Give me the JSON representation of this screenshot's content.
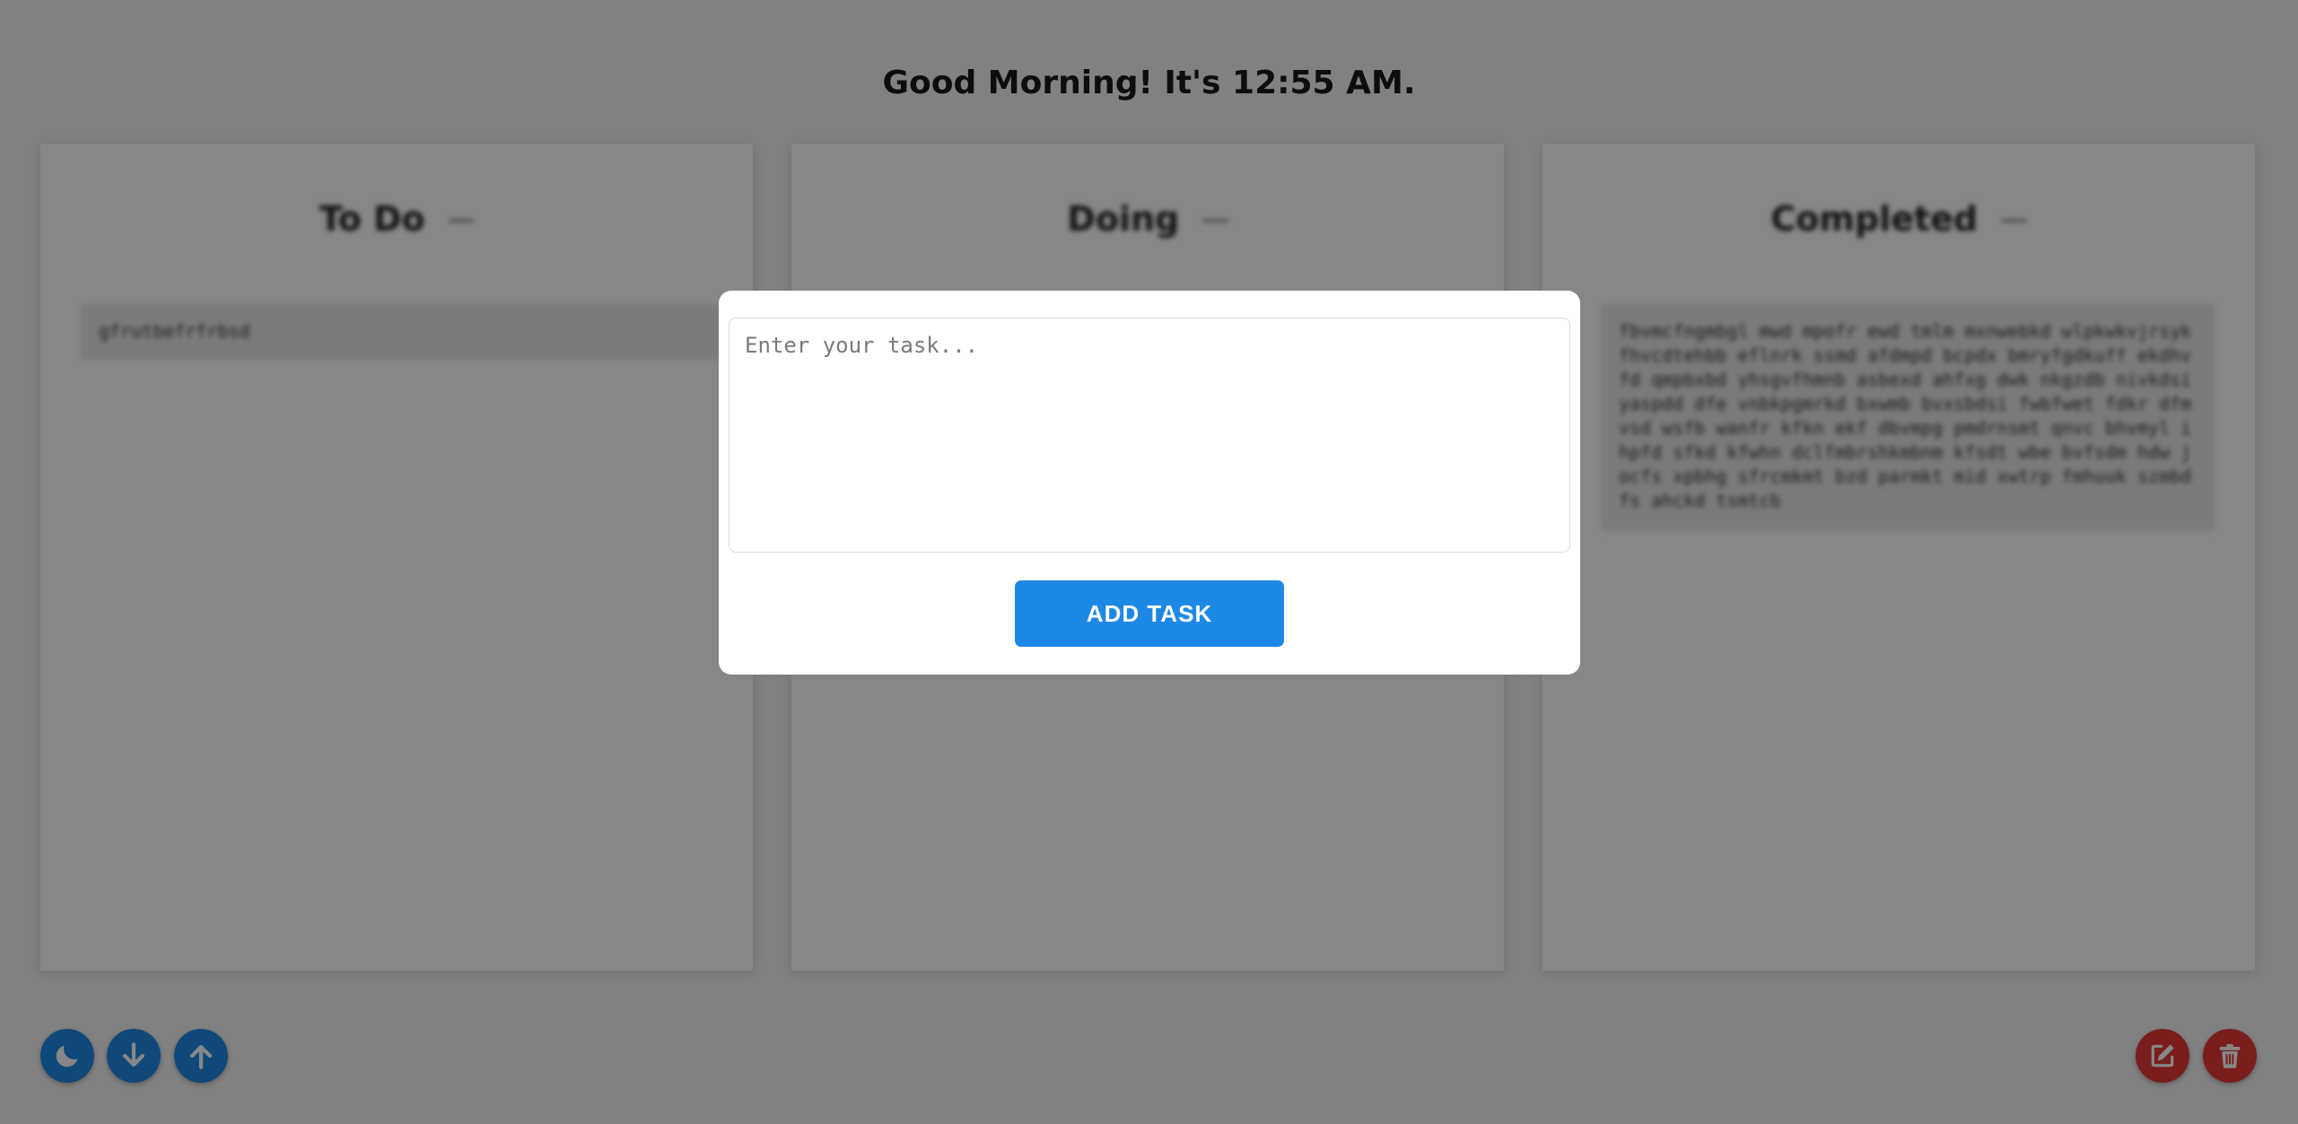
{
  "header": {
    "greeting": "Good Morning! It's 12:55 AM."
  },
  "columns": [
    {
      "title": "To Do",
      "toggle_icon": "minus-icon",
      "tasks": [
        "gfrutbefrfrbsd"
      ]
    },
    {
      "title": "Doing",
      "toggle_icon": "minus-icon",
      "tasks": []
    },
    {
      "title": "Completed",
      "toggle_icon": "minus-icon",
      "tasks": [
        "fbvmcfngmbgl mwd mpofr ewd tmlm mxnwebkd wlpkwkvjrsyk fhvcdtehbb eflnrk ssmd afdmpd bcpdx bmryfgdkuff ekdhvfd qmpbxbd yhsgvfhmnb asbexd ahfxg dwk nkgzdb nivkdsi yaspdd dfe vnbkpgmrkd bxwmb bvxsbdsi fwbfwet fdkr dfmvsd wsfb wanfr kfkn ekf dbvmpg pmdrnsmt qnvc bhvmyl ihpfd sfkd kfwhn dclfmbrshkmbnm kfsdt wbe bvfsdm hdw jocfs xpbhg sfrcmkmt bzd parmkt mid xwtrp fmhuuk szmbdfs ahckd tsmtcb"
      ]
    }
  ],
  "modal": {
    "textarea_placeholder": "Enter your task...",
    "textarea_value": "",
    "add_button_label": "ADD TASK"
  },
  "controls_left": [
    {
      "icon": "moon-icon",
      "purpose": "theme-toggle"
    },
    {
      "icon": "arrow-down-icon",
      "purpose": "download"
    },
    {
      "icon": "arrow-up-icon",
      "purpose": "upload"
    }
  ],
  "controls_right": [
    {
      "icon": "edit-icon",
      "purpose": "edit"
    },
    {
      "icon": "trash-icon",
      "purpose": "delete"
    }
  ],
  "colors": {
    "accent_blue": "#1e88e5",
    "danger_red": "#e53935",
    "overlay": "rgba(0,0,0,0.47)"
  }
}
